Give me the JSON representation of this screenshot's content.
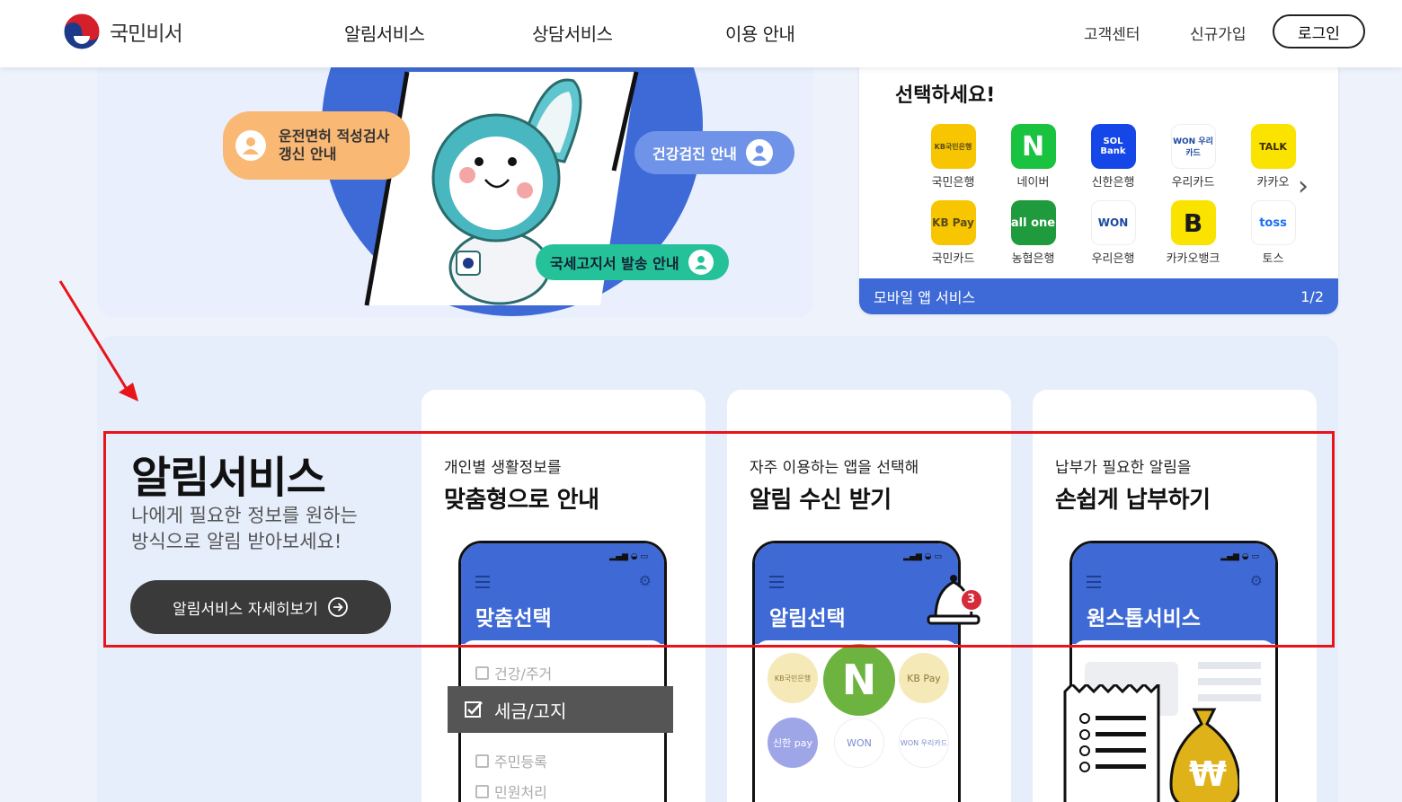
{
  "header": {
    "logo_text": "국민비서",
    "nav": [
      "알림서비스",
      "상담서비스",
      "이용 안내"
    ],
    "util": [
      "고객센터",
      "신규가입"
    ],
    "login_label": "로그인"
  },
  "hero": {
    "bubbles": [
      "운전면허 적성검사 갱신 안내",
      "건강검진 안내",
      "국세고지서 발송 안내"
    ],
    "bubble1_line1": "운전면허 적성검사",
    "bubble1_line2": "갱신 안내",
    "bubble2": "건강검진 안내",
    "bubble3": "국세고지서 발송 안내"
  },
  "app_panel": {
    "title": "선택하세요!",
    "apps": [
      {
        "label": "국민은행",
        "icon": "KB국민은행",
        "bg": "#f7c600",
        "fg": "#5a4a1a"
      },
      {
        "label": "네이버",
        "icon": "N",
        "bg": "#19c340",
        "fg": "#ffffff"
      },
      {
        "label": "신한은행",
        "icon": "SOL Bank",
        "bg": "#1547e8",
        "fg": "#ffffff"
      },
      {
        "label": "우리카드",
        "icon": "WON 우리카드",
        "bg": "#ffffff",
        "fg": "#1a4aa0"
      },
      {
        "label": "카카오",
        "icon": "TALK",
        "bg": "#fbe300",
        "fg": "#3a2a00"
      },
      {
        "label": "국민카드",
        "icon": "KB Pay",
        "bg": "#f7c600",
        "fg": "#5a4a1a"
      },
      {
        "label": "농협은행",
        "icon": "all one",
        "bg": "#1f9a3c",
        "fg": "#ffffff"
      },
      {
        "label": "우리은행",
        "icon": "WON",
        "bg": "#ffffff",
        "fg": "#1a4aa0"
      },
      {
        "label": "카카오뱅크",
        "icon": "B",
        "bg": "#fbe300",
        "fg": "#1a1a1a"
      },
      {
        "label": "토스",
        "icon": "toss",
        "bg": "#ffffff",
        "fg": "#1c6ef2"
      }
    ],
    "bar_label": "모바일 앱 서비스",
    "page_indicator": "1/2"
  },
  "service": {
    "title": "알림서비스",
    "subtitle_line1": "나에게 필요한 정보를 원하는",
    "subtitle_line2": "방식으로 알림 받아보세요!",
    "button_label": "알림서비스 자세히보기",
    "cards": [
      {
        "small": "개인별 생활정보를",
        "big": "맞춤형으로 안내",
        "phone_title": "맞춤선택"
      },
      {
        "small": "자주 이용하는 앱을 선택해",
        "big": "알림 수신 받기",
        "phone_title": "알림선택"
      },
      {
        "small": "납부가 필요한 알림을",
        "big": "손쉽게 납부하기",
        "phone_title": "원스톱서비스"
      }
    ],
    "checklist": [
      "건강/주거",
      "세금/고지",
      "주민등록",
      "민원처리"
    ],
    "badge_count": "3",
    "phone2_apps": [
      "KB국민은행",
      "N",
      "KB Pay",
      "신한 pay",
      "WON",
      "WON 우리카드"
    ],
    "won_symbol": "₩"
  },
  "colors": {
    "brand_blue": "#3d6ad6",
    "annotation_red": "#e8141a",
    "button_dark": "#3a3a3a"
  }
}
